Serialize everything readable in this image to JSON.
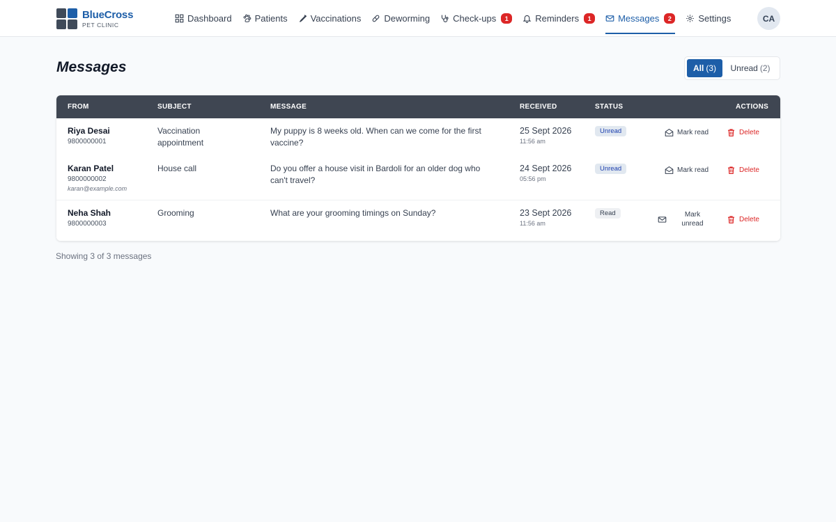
{
  "brand": {
    "name": "BlueCross",
    "subtitle": "PET CLINIC"
  },
  "nav": [
    {
      "label": "Dashboard",
      "icon": "dashboard-icon"
    },
    {
      "label": "Patients",
      "icon": "paw-icon"
    },
    {
      "label": "Vaccinations",
      "icon": "syringe-icon"
    },
    {
      "label": "Deworming",
      "icon": "pill-icon"
    },
    {
      "label": "Check-ups",
      "icon": "stethoscope-icon",
      "badge": "1"
    },
    {
      "label": "Reminders",
      "icon": "bell-icon",
      "badge": "1"
    },
    {
      "label": "Messages",
      "icon": "mail-icon",
      "badge": "2",
      "active": true
    },
    {
      "label": "Settings",
      "icon": "gear-icon"
    }
  ],
  "user": {
    "initials": "CA"
  },
  "page": {
    "title": "Messages"
  },
  "filter": {
    "all_label": "All",
    "all_count": "(3)",
    "unread_label": "Unread",
    "unread_count": "(2)"
  },
  "table": {
    "headers": {
      "from": "FROM",
      "subject": "SUBJECT",
      "message": "MESSAGE",
      "received": "RECEIVED",
      "status": "STATUS",
      "actions": "ACTIONS"
    },
    "rows": [
      {
        "name": "Riya Desai",
        "phone": "9800000001",
        "email": "",
        "subject_line1": "Vaccination",
        "subject_line2": "appointment",
        "message_line1": "My puppy is 8 weeks old. When can we come for the first",
        "message_line2": "vaccine?",
        "date": "25 Sept 2026",
        "time": "11:56 am",
        "status": "Unread",
        "toggle_label": "Mark read",
        "delete_label": "Delete"
      },
      {
        "name": "Karan Patel",
        "phone": "9800000002",
        "email": "karan@example.com",
        "subject_line1": "House call",
        "subject_line2": "",
        "message_line1": "Do you offer a house visit in Bardoli for an older dog who",
        "message_line2": "can't travel?",
        "date": "24 Sept 2026",
        "time": "05:56 pm",
        "status": "Unread",
        "toggle_label": "Mark read",
        "delete_label": "Delete"
      },
      {
        "name": "Neha Shah",
        "phone": "9800000003",
        "email": "",
        "subject_line1": "Grooming",
        "subject_line2": "",
        "message_line1": "What are your grooming timings on Sunday?",
        "message_line2": "",
        "date": "23 Sept 2026",
        "time": "11:56 am",
        "status": "Read",
        "toggle_label_line1": "Mark",
        "toggle_label_line2": "unread",
        "delete_label": "Delete"
      }
    ]
  },
  "footer": {
    "count_text": "Showing 3 of 3 messages"
  },
  "colors": {
    "accent": "#1d5ea8",
    "header_bg": "#3f4652",
    "badge": "#dc2626",
    "delete": "#dc2626"
  }
}
